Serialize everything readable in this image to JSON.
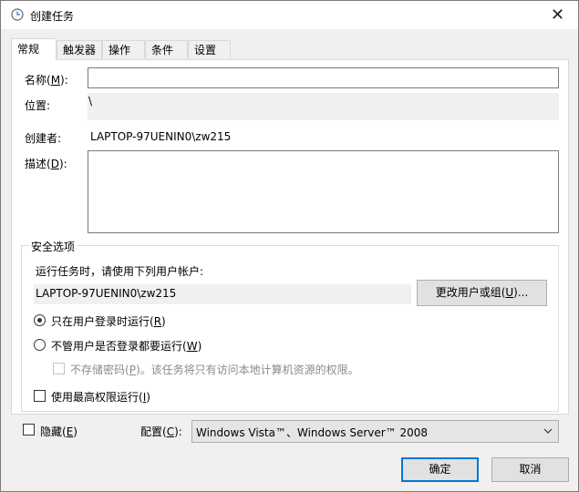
{
  "window": {
    "title": "创建任务",
    "close_glyph": "✕",
    "icon": "clock-icon"
  },
  "tabs": [
    {
      "label": "常规",
      "active": true
    },
    {
      "label": "触发器"
    },
    {
      "label": "操作"
    },
    {
      "label": "条件"
    },
    {
      "label": "设置"
    }
  ],
  "general": {
    "name_label_pre": "名称(",
    "name_label_key": "M",
    "name_label_post": "):",
    "name_value": "",
    "location_label": "位置:",
    "location_value": "\\",
    "author_label": "创建者:",
    "author_value": "LAPTOP-97UENIN0\\zw215",
    "desc_label_pre": "描述(",
    "desc_label_key": "D",
    "desc_label_post": "):",
    "desc_value": ""
  },
  "security": {
    "title": "安全选项",
    "run_as_label": "运行任务时，请使用下列用户帐户:",
    "user_account": "LAPTOP-97UENIN0\\zw215",
    "change_btn_pre": "更改用户或组(",
    "change_btn_key": "U",
    "change_btn_post": ")...",
    "radio1_pre": "只在用户登录时运行(",
    "radio1_key": "R",
    "radio1_post": ")",
    "radio1_selected": true,
    "radio2_pre": "不管用户是否登录都要运行(",
    "radio2_key": "W",
    "radio2_post": ")",
    "no_store_pre": "不存储密码(",
    "no_store_key": "P",
    "no_store_post": ")。该任务将只有访问本地计算机资源的权限。",
    "highest_pre": "使用最高权限运行(",
    "highest_key": "I",
    "highest_post": ")"
  },
  "bottom": {
    "hidden_pre": "隐藏(",
    "hidden_key": "E",
    "hidden_post": ")",
    "config_pre": "配置(",
    "config_key": "C",
    "config_post": "):",
    "config_value": "Windows Vista™、Windows Server™ 2008"
  },
  "buttons": {
    "ok": "确定",
    "cancel": "取消"
  },
  "colors": {
    "default_button_border": "#0078d7",
    "panel_bg": "#ffffff",
    "window_bg": "#f0f0f0"
  }
}
